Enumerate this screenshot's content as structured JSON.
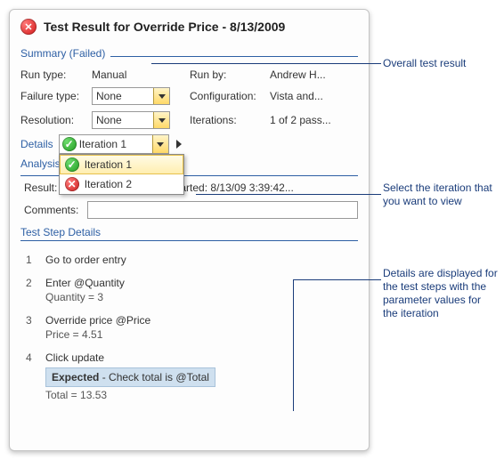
{
  "header": {
    "title": "Test Result for Override Price - 8/13/2009"
  },
  "summary": {
    "label": "Summary (Failed)"
  },
  "runInfo": {
    "runTypeLabel": "Run type:",
    "runType": "Manual",
    "runByLabel": "Run by:",
    "runBy": "Andrew H...",
    "failureTypeLabel": "Failure type:",
    "failureType": "None",
    "configLabel": "Configuration:",
    "config": "Vista and...",
    "resolutionLabel": "Resolution:",
    "resolution": "None",
    "iterationsLabel": "Iterations:",
    "iterations": "1 of 2 pass..."
  },
  "detailsLabel": "Details",
  "iterationCombo": {
    "selected": "Iteration 1",
    "options": [
      {
        "label": "Iteration 1",
        "status": "pass"
      },
      {
        "label": "Iteration 2",
        "status": "fail"
      }
    ]
  },
  "analysis": {
    "label": "Analysis",
    "resultLabel": "Result:",
    "dateStartedLabel": "Date started:",
    "dateStarted": "8/13/09 3:39:42...",
    "commentsLabel": "Comments:",
    "comments": ""
  },
  "stepsLabel": "Test Step Details",
  "steps": [
    {
      "n": "1",
      "text": "Go to order entry"
    },
    {
      "n": "2",
      "text": "Enter @Quantity",
      "sub": "Quantity = 3"
    },
    {
      "n": "3",
      "text": "Override price @Price",
      "sub": "Price = 4.51"
    },
    {
      "n": "4",
      "text": "Click update",
      "expectedPrefix": "Expected",
      "expectedRest": " - Check total is @Total",
      "sub": "Total = 13.53"
    }
  ],
  "annotations": {
    "overall": "Overall test result",
    "selectIter": "Select the iteration that you want to view",
    "stepDetails": "Details are displayed for the test steps with the parameter values for the iteration"
  }
}
